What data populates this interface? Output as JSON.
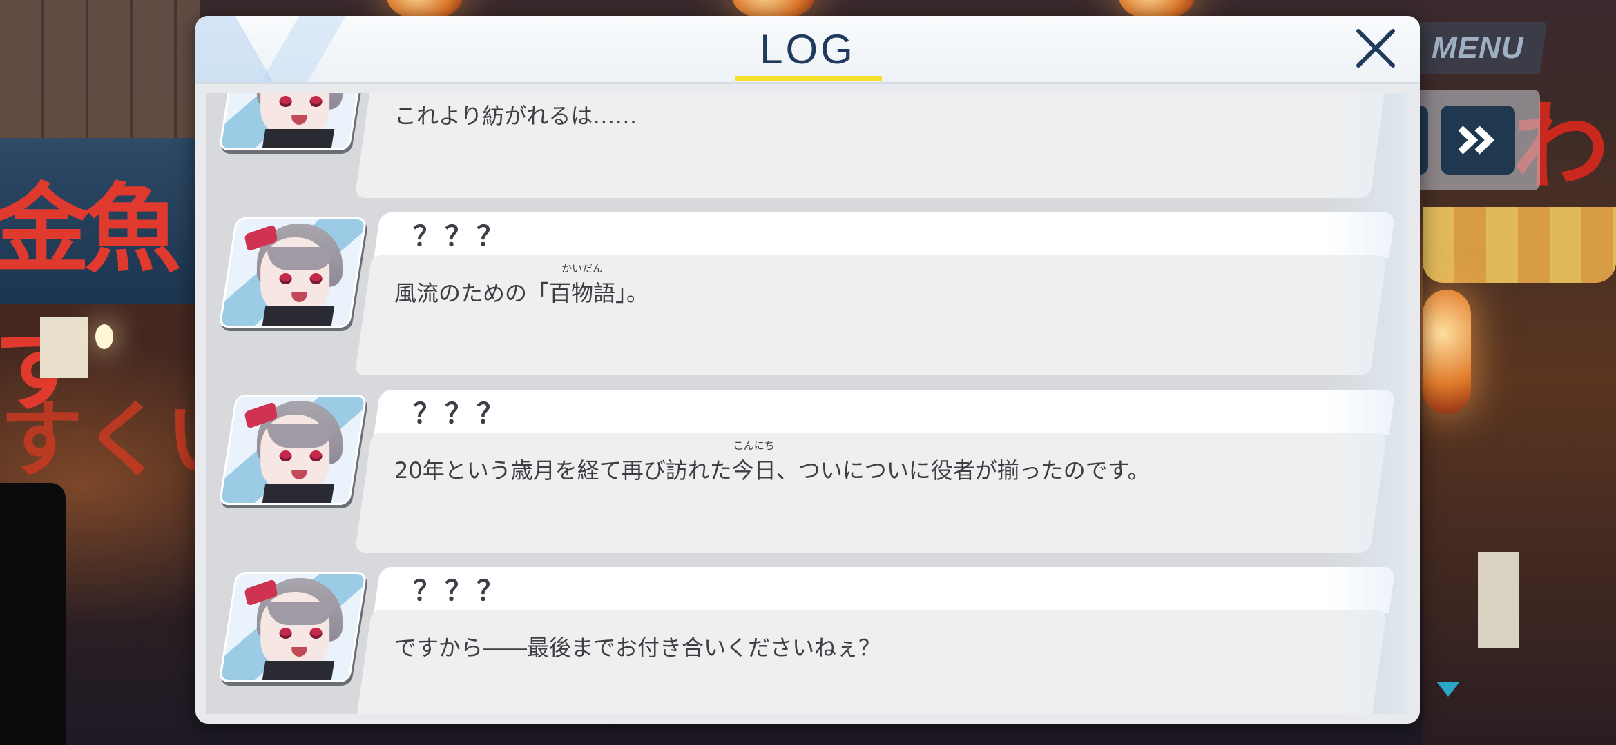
{
  "window": {
    "title": "LOG",
    "close_icon": "close-icon"
  },
  "controls": {
    "menu_label": "MENU",
    "skip_icon": "fast-forward-icon",
    "scroll_indicator_icon": "triangle-down-icon"
  },
  "background": {
    "sign_left": "金魚す",
    "sign_left_lower": "すくい",
    "sign_right": "わ"
  },
  "log": {
    "entries": [
      {
        "speaker": "？？？",
        "text_before": "これより紡がれるは……",
        "ruby_base": "",
        "ruby_text": "",
        "text_after": ""
      },
      {
        "speaker": "？？？",
        "text_before": "風流のための「",
        "ruby_base": "百物語",
        "ruby_text": "かいだん",
        "text_after": "」。"
      },
      {
        "speaker": "？？？",
        "text_before": "20年という歳月を経て再び訪れた",
        "ruby_base": "今日",
        "ruby_text": "こんにち",
        "text_after": "、ついについに役者が揃ったのです。"
      },
      {
        "speaker": "？？？",
        "text_before": "ですから――最後までお付き合いくださいねぇ？",
        "ruby_base": "",
        "ruby_text": "",
        "text_after": ""
      }
    ]
  },
  "colors": {
    "title": "#1f3a5c",
    "title_underline": "#f6e12a",
    "skip_button": "#1f3850",
    "scroll_indicator": "#2aa6c8"
  }
}
